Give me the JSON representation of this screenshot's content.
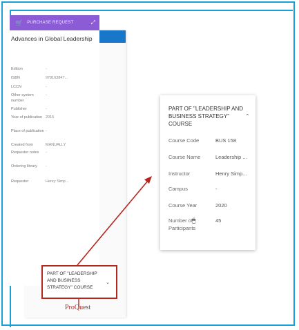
{
  "panel": {
    "toolbar_icons": [
      "☰",
      "⚑",
      "○",
      "■",
      "●",
      "⚙",
      "▣"
    ],
    "purchase_request": "PURCHASE REQUEST",
    "title": "Advances in Global Leadership",
    "fields": [
      {
        "k": "Edition",
        "v": "-"
      },
      {
        "k": "ISBN",
        "v": "978163847..."
      },
      {
        "k": "LCCN",
        "v": "-"
      },
      {
        "k": "Other system number",
        "v": "-"
      },
      {
        "k": "Publisher",
        "v": "-"
      },
      {
        "k": "Year of publication",
        "v": "2015"
      },
      {
        "k": "Place of publication",
        "v": "-"
      },
      {
        "k": "Created from",
        "v": "MANUALLY"
      },
      {
        "k": "Requester notes",
        "v": "-"
      },
      {
        "k": "Ordering library",
        "v": "-"
      },
      {
        "k": "Requester",
        "v": "Henry Simp..."
      }
    ],
    "course_label": "PART OF \"LEADERSHIP AND BUSINESS STRATEGY\" COURSE",
    "proquest": "ProQuest"
  },
  "popup": {
    "title": "PART OF \"LEADERSHIP AND BUSINESS STRATEGY\" COURSE",
    "rows": [
      {
        "k": "Course Code",
        "v": "BUS 158"
      },
      {
        "k": "Course Name",
        "v": "Leadership ..."
      },
      {
        "k": "Instructor",
        "v": "Henry Simp..."
      },
      {
        "k": "Campus",
        "v": "-"
      },
      {
        "k": "Course Year",
        "v": "2020"
      },
      {
        "k": "Number of Participants",
        "v": "45"
      }
    ]
  },
  "colors": {
    "accent_blue": "#1877c9",
    "purchase_purple": "#8b5cd6",
    "highlight_red": "#b5261f",
    "frame_cyan": "#1aa0d8"
  }
}
